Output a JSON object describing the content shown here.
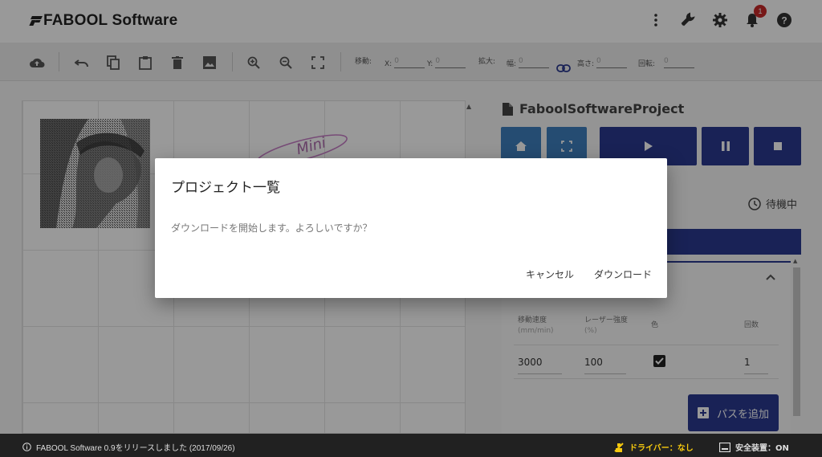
{
  "app": {
    "logo_text": "FABOOL Software"
  },
  "header": {
    "notification_count": "1"
  },
  "toolbar": {
    "move_label": "移動:",
    "x_label": "X:",
    "x_value": "0",
    "y_label": "Y:",
    "y_value": "0",
    "scale_label": "拡大:",
    "width_label": "幅:",
    "width_value": "0",
    "height_label": "高さ:",
    "height_value": "0",
    "rotate_label": "回転:",
    "rotate_value": "0"
  },
  "canvas": {
    "overlay_text": "Mini"
  },
  "project": {
    "name": "FaboolSoftwareProject",
    "status": "待機中"
  },
  "table": {
    "headers": {
      "speed": "移動速度",
      "speed_unit": "(mm/min)",
      "power": "レーザー強度",
      "power_unit": "(%)",
      "color": "色",
      "passes": "回数"
    },
    "row": {
      "speed": "3000",
      "power": "100",
      "passes": "1"
    },
    "add_path_label": "パスを追加"
  },
  "footer": {
    "message": "FABOOL Software 0.9をリリースしました (2017/09/26)",
    "driver_label": "ドライバー：なし",
    "safety_label": "安全装置：ON"
  },
  "dialog": {
    "title": "プロジェクト一覧",
    "message": "ダウンロードを開始します。よろしいですか？",
    "cancel_label": "キャンセル",
    "confirm_label": "ダウンロード"
  },
  "colors": {
    "primary": "#2b3990",
    "secondary": "#3f7fbf",
    "footer_bg": "#212121",
    "warning": "#f6c90e",
    "badge": "#c62828"
  }
}
